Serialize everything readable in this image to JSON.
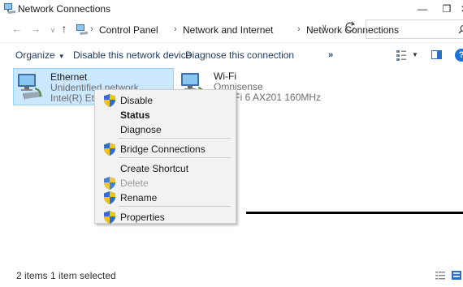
{
  "window": {
    "title": "Network Connections",
    "min_glyph": "—",
    "max_glyph": "❐",
    "close_glyph": "✕"
  },
  "nav": {
    "back_glyph": "←",
    "forward_glyph": "→",
    "recent_glyph": "∨",
    "up_glyph": "↑",
    "breadcrumb": [
      "Control Panel",
      "Network and Internet",
      "Network Connections"
    ],
    "separator": "›",
    "dropdown_glyph": "∨",
    "search_placeholder": ""
  },
  "toolbar": {
    "organize": "Organize",
    "organize_caret": "▼",
    "disable": "Disable this network device",
    "diagnose": "Diagnose this connection",
    "more": "»",
    "view_caret": "▼",
    "help": "?"
  },
  "items": [
    {
      "name": "Ethernet",
      "status": "Unidentified network",
      "adapter": "Intel(R) Ethernet",
      "selected": true
    },
    {
      "name": "Wi-Fi",
      "status": "Omnisense",
      "adapter": ") Wi-Fi 6 AX201 160MHz",
      "selected": false
    }
  ],
  "context_menu": [
    {
      "label": "Disable",
      "shield": true,
      "bold": false,
      "disabled": false
    },
    {
      "label": "Status",
      "shield": false,
      "bold": true,
      "disabled": false
    },
    {
      "label": "Diagnose",
      "shield": false,
      "bold": false,
      "disabled": false
    },
    {
      "label": "Bridge Connections",
      "shield": true,
      "bold": false,
      "disabled": false
    },
    {
      "label": "Create Shortcut",
      "shield": false,
      "bold": false,
      "disabled": false
    },
    {
      "label": "Delete",
      "shield": true,
      "bold": false,
      "disabled": true
    },
    {
      "label": "Rename",
      "shield": true,
      "bold": false,
      "disabled": false
    },
    {
      "label": "Properties",
      "shield": true,
      "bold": false,
      "disabled": false
    }
  ],
  "status_bar": {
    "text": "2 items 1 item selected"
  },
  "colors": {
    "selection_bg": "#cce8ff",
    "selection_border": "#99d1ff",
    "link_text": "#1e3a5f",
    "menu_bg": "#f2f2f2"
  }
}
